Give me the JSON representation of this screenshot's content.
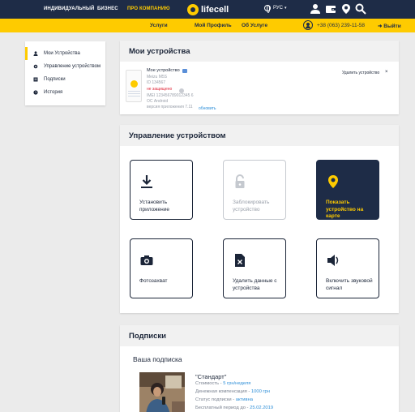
{
  "topnav": {
    "segments": [
      "ИНДИВИДУАЛЬНЫЙ",
      "БИЗНЕС",
      "ПРО КОМПАНИЮ"
    ],
    "active_segment": "ПРО КОМПАНИЮ",
    "logo": "lifecell",
    "language": "РУС",
    "icons": [
      "user-icon",
      "wallet-icon",
      "location-pin-icon",
      "search-icon"
    ],
    "accent_color": "#fecb00",
    "dark_color": "#1e2c47"
  },
  "subnav": {
    "tabs": [
      "Услуги",
      "Мой Профиль",
      "Об Услуге"
    ],
    "phone": "+38 (063) 239-11-58",
    "exit_label": "Выйти"
  },
  "sidebar": {
    "items": [
      {
        "label": "Мои Устройства",
        "icon": "user-icon",
        "active": true
      },
      {
        "label": "Управление устройством",
        "icon": "gear-icon",
        "active": false
      },
      {
        "label": "Подписки",
        "icon": "list-icon",
        "active": false
      },
      {
        "label": "История",
        "icon": "clock-icon",
        "active": false
      }
    ]
  },
  "devices": {
    "header": "Мои устройства",
    "device": {
      "title": "Мое устройство",
      "model": "Meizu M5S",
      "id": "ID 134567",
      "status": "не защищено",
      "imei": "IMEI 123456789012345 6",
      "os": "ОС Android",
      "app_version": "версия приложения 7.11",
      "update_label": "обновить",
      "remove_label": "Удалить устройство",
      "close": "×"
    }
  },
  "management": {
    "header": "Управление устройством",
    "tiles": [
      {
        "label": "Установить приложение",
        "icon": "download-icon",
        "state": "normal"
      },
      {
        "label": "Заблокировать устройство",
        "icon": "lock-icon",
        "state": "disabled"
      },
      {
        "label": "Показать устройство на карте",
        "icon": "map-pin-icon",
        "state": "active"
      },
      {
        "label": "Фотозахват",
        "icon": "camera-icon",
        "state": "normal"
      },
      {
        "label": "Удалить данные с устройства",
        "icon": "delete-file-icon",
        "state": "normal"
      },
      {
        "label": "Включить звуковой сигнал",
        "icon": "speaker-icon",
        "state": "normal"
      }
    ]
  },
  "subscriptions": {
    "header": "Подписки",
    "title": "Ваша подписка",
    "plan": {
      "name": "\"Стандарт\"",
      "rows": [
        {
          "label": "Стоимость - ",
          "value": "5 грн/неделя"
        },
        {
          "label": "Денежная компенсация - ",
          "value": "1000 грн"
        },
        {
          "label": "Статус подписки - ",
          "value": "активна"
        },
        {
          "label": "Бесплатный период до - ",
          "value": "25.02.2019"
        }
      ]
    }
  }
}
